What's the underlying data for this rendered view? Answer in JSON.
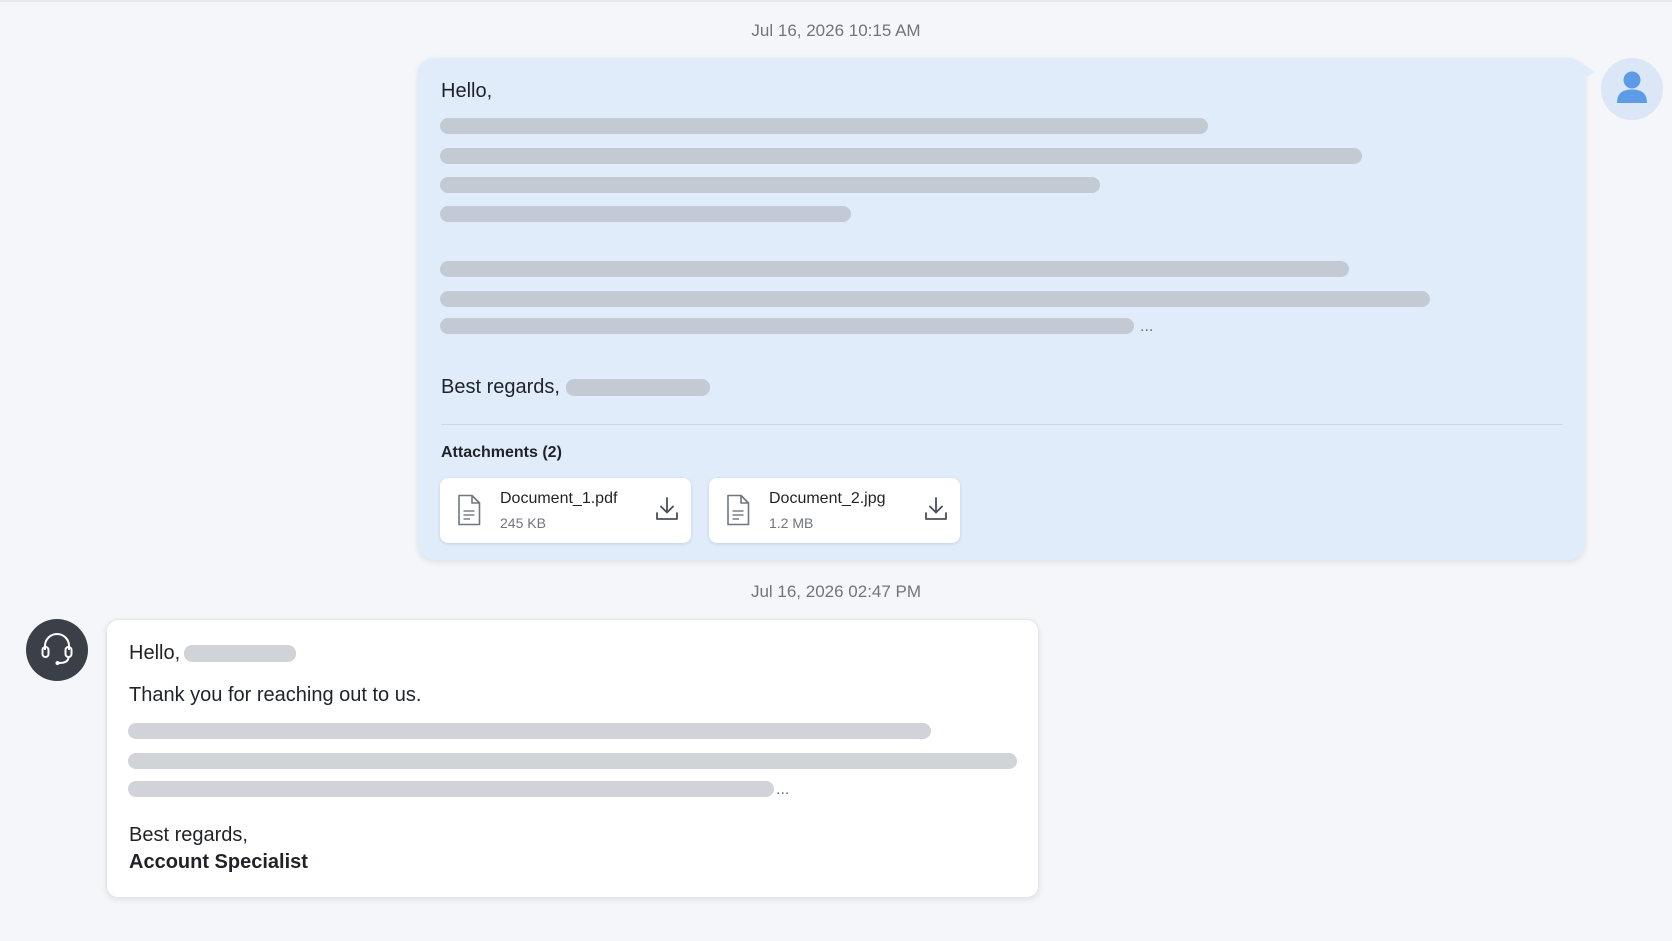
{
  "conversation": {
    "messages": [
      {
        "timestamp": "Jul 16, 2026 10:15 AM",
        "greeting": "Hello,",
        "ellipsis": "...",
        "closing": "Best regards,",
        "attachments_title": "Attachments (2)",
        "attachments": [
          {
            "name": "Document_1.pdf",
            "size": "245 KB",
            "icon": "file-icon",
            "action_icon": "download-icon"
          },
          {
            "name": "Document_2.jpg",
            "size": "1.2 MB",
            "icon": "file-icon",
            "action_icon": "download-icon"
          }
        ],
        "avatar_icon": "user-icon"
      },
      {
        "timestamp": "Jul 16, 2026 02:47 PM",
        "greeting": "Hello,",
        "intro": "Thank you for reaching out to us.",
        "ellipsis": "...",
        "closing": "Best regards,",
        "signature": "Account Specialist",
        "avatar_icon": "headset-icon"
      }
    ]
  },
  "colors": {
    "user_bubble": "#e1ecfb",
    "agent_avatar": "#3b4048",
    "user_avatar_icon": "#5e9be6",
    "redaction_bar": "#c4cad3"
  }
}
